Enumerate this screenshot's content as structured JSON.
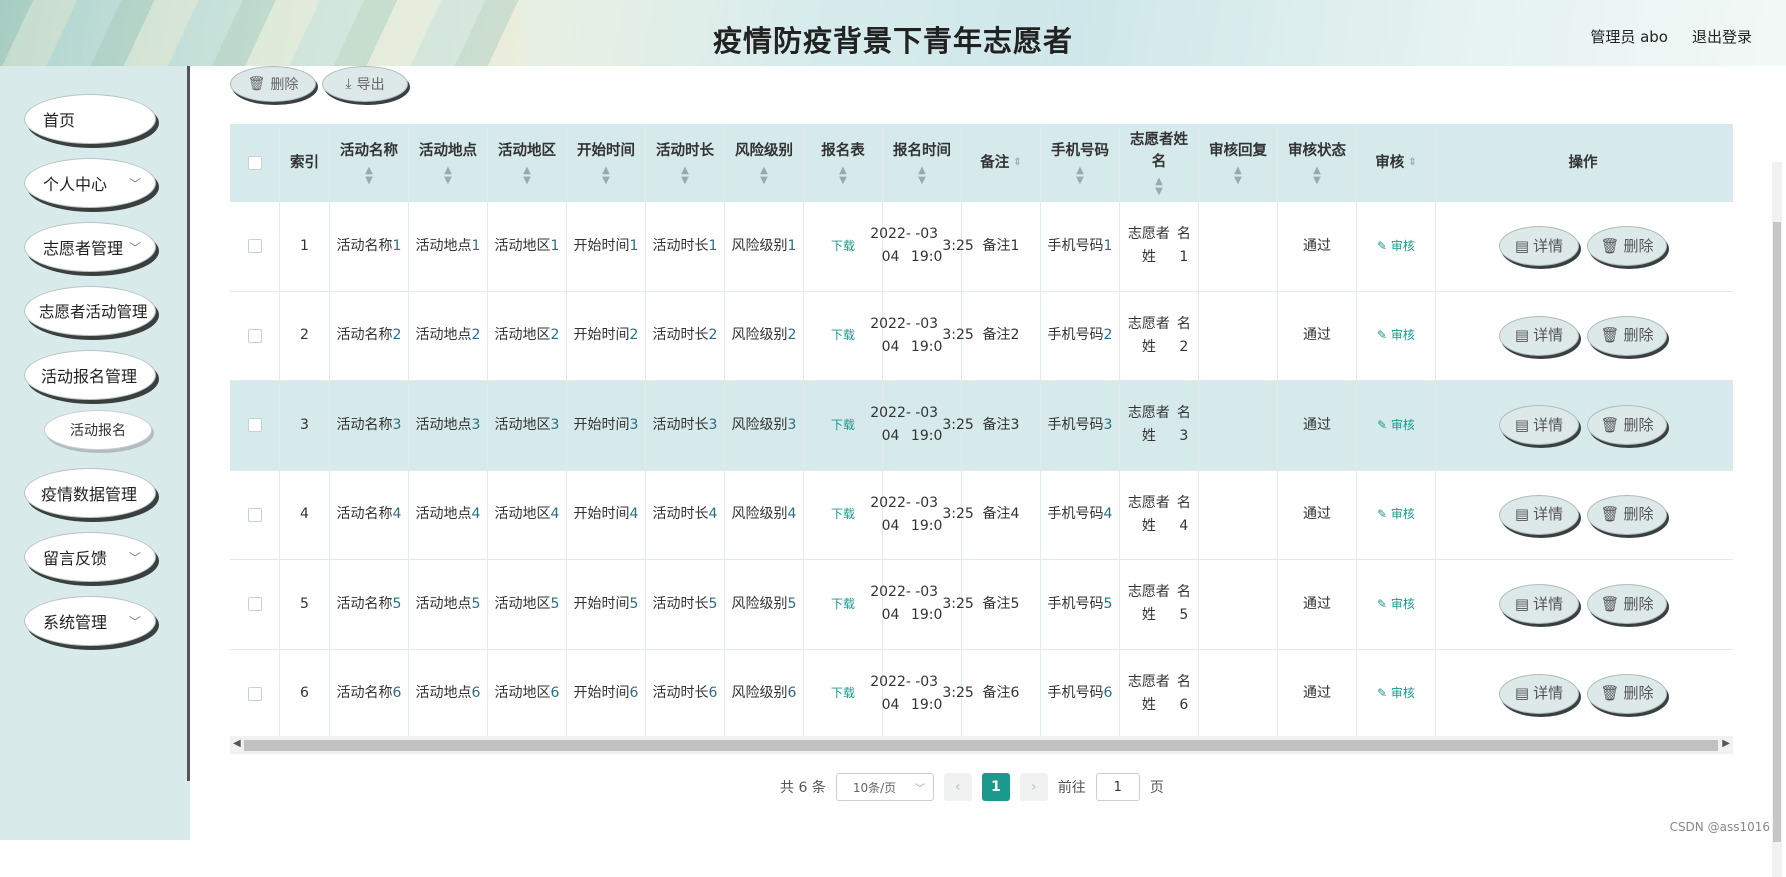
{
  "header": {
    "title": "疫情防疫背景下青年志愿者",
    "user_label": "管理员 abo",
    "logout_label": "退出登录"
  },
  "sidebar": {
    "items": [
      {
        "label": "首页",
        "has_arrow": false
      },
      {
        "label": "个人中心",
        "has_arrow": true
      },
      {
        "label": "志愿者管理",
        "has_arrow": true
      },
      {
        "label": "志愿者活动管理",
        "has_arrow": false
      },
      {
        "label": "活动报名管理",
        "has_arrow": false
      },
      {
        "label": "疫情数据管理",
        "has_arrow": false
      },
      {
        "label": "留言反馈",
        "has_arrow": true
      },
      {
        "label": "系统管理",
        "has_arrow": true
      }
    ],
    "subitem": "活动报名"
  },
  "toolbar": {
    "delete_label": "删除",
    "export_label": "导出"
  },
  "table": {
    "headers": [
      "索引",
      "活动名称",
      "活动地点",
      "活动地区",
      "开始时间",
      "活动时长",
      "风险级别",
      "报名表",
      "报名时间",
      "备注",
      "手机号码",
      "志愿者姓名",
      "审核回复",
      "审核状态",
      "审核",
      "操作"
    ],
    "download_label": "下载",
    "audit_label": "审核",
    "detail_label": "详情",
    "row_delete_label": "删除",
    "rows": [
      {
        "idx": "1",
        "name": [
          "活动名称",
          "1"
        ],
        "place": [
          "活动地点",
          "1"
        ],
        "area": [
          "活动地区",
          "1"
        ],
        "start": [
          "开始时间",
          "1"
        ],
        "dur": [
          "活动时长",
          "1"
        ],
        "risk": [
          "风险级别",
          "1"
        ],
        "time": [
          "2022-04",
          "-03 19:0",
          "3:25"
        ],
        "note": "备注1",
        "phone": [
          "手机号码",
          "1"
        ],
        "vname": [
          "志愿者姓",
          "名1"
        ],
        "reply": "",
        "status": "通过"
      },
      {
        "idx": "2",
        "name": [
          "活动名称",
          "2"
        ],
        "place": [
          "活动地点",
          "2"
        ],
        "area": [
          "活动地区",
          "2"
        ],
        "start": [
          "开始时间",
          "2"
        ],
        "dur": [
          "活动时长",
          "2"
        ],
        "risk": [
          "风险级别",
          "2"
        ],
        "time": [
          "2022-04",
          "-03 19:0",
          "3:25"
        ],
        "note": "备注2",
        "phone": [
          "手机号码",
          "2"
        ],
        "vname": [
          "志愿者姓",
          "名2"
        ],
        "reply": "",
        "status": "通过"
      },
      {
        "idx": "3",
        "name": [
          "活动名称",
          "3"
        ],
        "place": [
          "活动地点",
          "3"
        ],
        "area": [
          "活动地区",
          "3"
        ],
        "start": [
          "开始时间",
          "3"
        ],
        "dur": [
          "活动时长",
          "3"
        ],
        "risk": [
          "风险级别",
          "3"
        ],
        "time": [
          "2022-04",
          "-03 19:0",
          "3:25"
        ],
        "note": "备注3",
        "phone": [
          "手机号码",
          "3"
        ],
        "vname": [
          "志愿者姓",
          "名3"
        ],
        "reply": "",
        "status": "通过"
      },
      {
        "idx": "4",
        "name": [
          "活动名称",
          "4"
        ],
        "place": [
          "活动地点",
          "4"
        ],
        "area": [
          "活动地区",
          "4"
        ],
        "start": [
          "开始时间",
          "4"
        ],
        "dur": [
          "活动时长",
          "4"
        ],
        "risk": [
          "风险级别",
          "4"
        ],
        "time": [
          "2022-04",
          "-03 19:0",
          "3:25"
        ],
        "note": "备注4",
        "phone": [
          "手机号码",
          "4"
        ],
        "vname": [
          "志愿者姓",
          "名4"
        ],
        "reply": "",
        "status": "通过"
      },
      {
        "idx": "5",
        "name": [
          "活动名称",
          "5"
        ],
        "place": [
          "活动地点",
          "5"
        ],
        "area": [
          "活动地区",
          "5"
        ],
        "start": [
          "开始时间",
          "5"
        ],
        "dur": [
          "活动时长",
          "5"
        ],
        "risk": [
          "风险级别",
          "5"
        ],
        "time": [
          "2022-04",
          "-03 19:0",
          "3:25"
        ],
        "note": "备注5",
        "phone": [
          "手机号码",
          "5"
        ],
        "vname": [
          "志愿者姓",
          "名5"
        ],
        "reply": "",
        "status": "通过"
      },
      {
        "idx": "6",
        "name": [
          "活动名称",
          "6"
        ],
        "place": [
          "活动地点",
          "6"
        ],
        "area": [
          "活动地区",
          "6"
        ],
        "start": [
          "开始时间",
          "6"
        ],
        "dur": [
          "活动时长",
          "6"
        ],
        "risk": [
          "风险级别",
          "6"
        ],
        "time": [
          "2022-04",
          "-03 19:0",
          "3:25"
        ],
        "note": "备注6",
        "phone": [
          "手机号码",
          "6"
        ],
        "vname": [
          "志愿者姓",
          "名6"
        ],
        "reply": "",
        "status": "通过"
      }
    ]
  },
  "pagination": {
    "total_label": "共 6 条",
    "page_size": "10条/页",
    "current_page": "1",
    "goto_label": "前往",
    "goto_value": "1",
    "page_suffix": "页"
  },
  "watermark": "CSDN @ass1016",
  "colors": {
    "accent": "#1a9a8c",
    "header_bg": "#d6eaec",
    "sidebar_bg": "#d8eaea"
  }
}
